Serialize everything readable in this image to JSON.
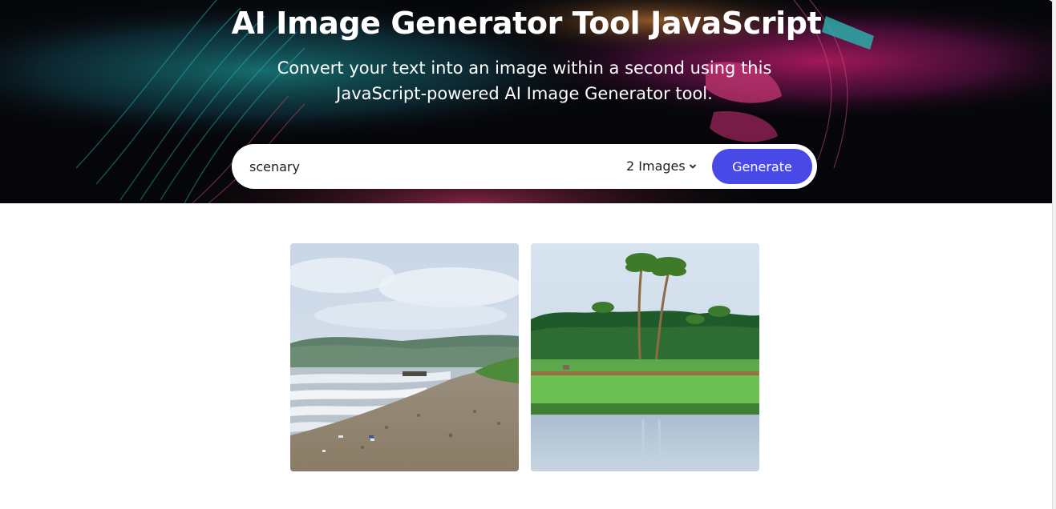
{
  "hero": {
    "title": "AI Image Generator Tool JavaScript",
    "subtitle": "Convert your text into an image within a second using this JavaScript-powered AI Image Generator tool.",
    "background_icon": "neon-face-art"
  },
  "search": {
    "prompt_value": "scenary",
    "image_count_selected": "2 Images",
    "generate_label": "Generate",
    "button_color": "#4949e7"
  },
  "gallery": {
    "images": [
      {
        "icon": "beach-scenery-image",
        "description_hint": "beach"
      },
      {
        "icon": "palm-field-scenery-image",
        "description_hint": "palm-field"
      }
    ]
  }
}
